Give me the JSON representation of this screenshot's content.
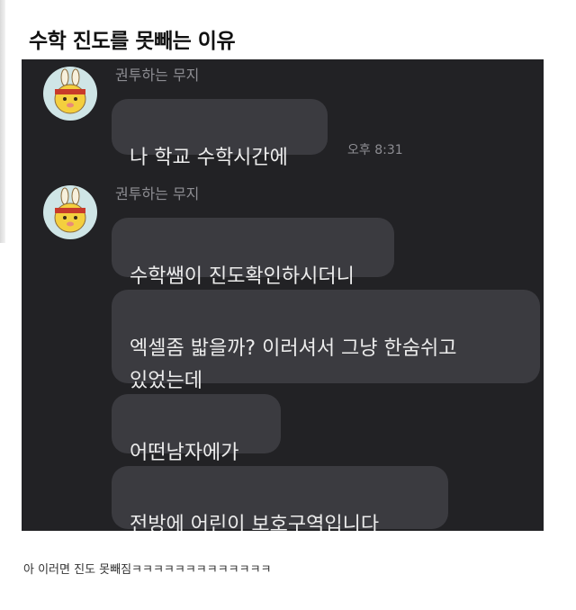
{
  "post": {
    "title": "수학 진도를 못빼는 이유",
    "caption": "아 이러면 진도 못빼짐ㅋㅋㅋㅋㅋㅋㅋㅋㅋㅋㅋㅋㅋ"
  },
  "chat": {
    "groups": [
      {
        "sender": "권투하는 무지",
        "messages": [
          {
            "text": "나 학교 수학시간에",
            "time": "오후 8:31"
          }
        ]
      },
      {
        "sender": "권투하는 무지",
        "messages": [
          {
            "text": "수학쌤이 진도확인하시더니"
          },
          {
            "text": "엑셀좀 밟을까? 이러셔서 그냥 한숨쉬고\n있었는데"
          },
          {
            "text": "어떤남자에가"
          },
          {
            "text": "전방에 어린이 보호구역입니다"
          }
        ]
      }
    ]
  },
  "colors": {
    "chat_background": "#222225",
    "bubble": "#3b3b40",
    "bubble_text": "#ececec",
    "meta_text": "#8d8d92",
    "avatar_background": "#cfe5e6"
  }
}
